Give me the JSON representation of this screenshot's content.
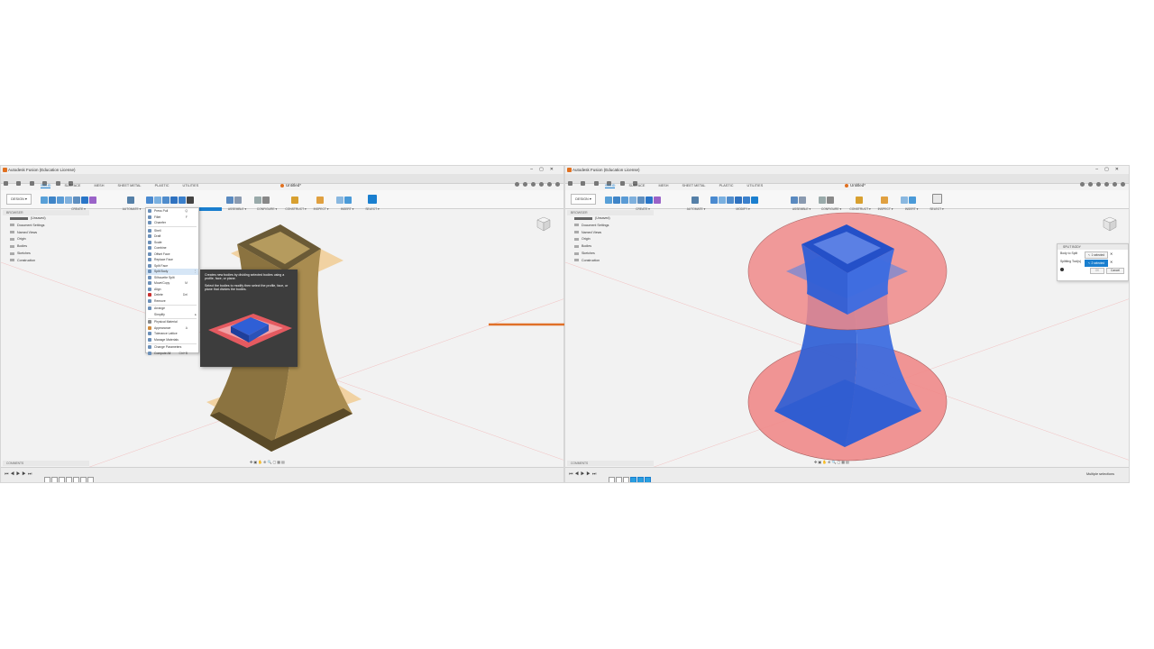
{
  "left_window": {
    "title": "Autodesk Fusion (Education License)",
    "doc_tab": "Untitled*",
    "workspace_tabs": [
      "SOLID",
      "SURFACE",
      "MESH",
      "SHEET METAL",
      "PLASTIC",
      "UTILITIES"
    ],
    "design_button": "DESIGN ▾",
    "ribbon_groups": [
      "CREATE ▾",
      "AUTOMATE ▾",
      "MODIFY ▾",
      "ASSEMBLE ▾",
      "CONFIGURE ▾",
      "CONSTRUCT ▾",
      "INSPECT ▾",
      "INSERT ▾",
      "SELECT ▾"
    ],
    "browser_header": "BROWSER",
    "browser_items": [
      "(Unsaved)",
      "Document Settings",
      "Named Views",
      "Origin",
      "Bodies",
      "Sketches",
      "Construction"
    ],
    "comments": "COMMENTS",
    "modify_menu": [
      {
        "label": "Press Pull",
        "shortcut": "Q"
      },
      {
        "label": "Fillet",
        "shortcut": "F"
      },
      {
        "label": "Chamfer",
        "shortcut": ""
      },
      {
        "label": "Shell",
        "shortcut": ""
      },
      {
        "label": "Draft",
        "shortcut": ""
      },
      {
        "label": "Scale",
        "shortcut": ""
      },
      {
        "label": "Combine",
        "shortcut": ""
      },
      {
        "label": "Offset Face",
        "shortcut": ""
      },
      {
        "label": "Replace Face",
        "shortcut": ""
      },
      {
        "label": "Split Face",
        "shortcut": ""
      },
      {
        "label": "Split Body",
        "shortcut": "⋮"
      },
      {
        "label": "Silhouette Split",
        "shortcut": ""
      },
      {
        "label": "Move/Copy",
        "shortcut": "M"
      },
      {
        "label": "Align",
        "shortcut": ""
      },
      {
        "label": "Delete",
        "shortcut": "Del"
      },
      {
        "label": "Remove",
        "shortcut": ""
      },
      {
        "label": "Arrange",
        "shortcut": ""
      },
      {
        "label": "Simplify",
        "shortcut": "▸"
      },
      {
        "label": "Physical Material",
        "shortcut": ""
      },
      {
        "label": "Appearance",
        "shortcut": "A"
      },
      {
        "label": "Tolerance Lattice",
        "shortcut": ""
      },
      {
        "label": "Manage Materials",
        "shortcut": ""
      },
      {
        "label": "Change Parameters",
        "shortcut": ""
      },
      {
        "label": "Compute All",
        "shortcut": "Ctrl+B"
      }
    ],
    "tooltip": {
      "line1": "Creates new bodies by dividing selected bodies using a profile, face, or plane.",
      "line2": "Select the bodies to modify then select the profile, face, or plane that divides the bodies."
    }
  },
  "right_window": {
    "title": "Autodesk Fusion (Education License)",
    "doc_tab": "Untitled*",
    "design_button": "DESIGN ▾",
    "browser_header": "BROWSER",
    "browser_items": [
      "(Unsaved)",
      "Document Settings",
      "Named Views",
      "Origin",
      "Bodies",
      "Sketches",
      "Construction"
    ],
    "comments": "COMMENTS",
    "split_body_dialog": {
      "title": "SPLIT BODY",
      "row1_label": "Body to Split",
      "row1_value": "↖ 1 selected",
      "row2_label": "Splitting Tool(s)",
      "row2_value": "↖ 2 selected",
      "ok": "OK",
      "cancel": "Cancel"
    },
    "status": "Multiple selections"
  },
  "colors": {
    "accent": "#1a7fcf",
    "arrow": "#e07028",
    "body_brown": "#8b7340",
    "body_blue": "#2f5fd6",
    "split_plane_red": "#f08a8a"
  }
}
